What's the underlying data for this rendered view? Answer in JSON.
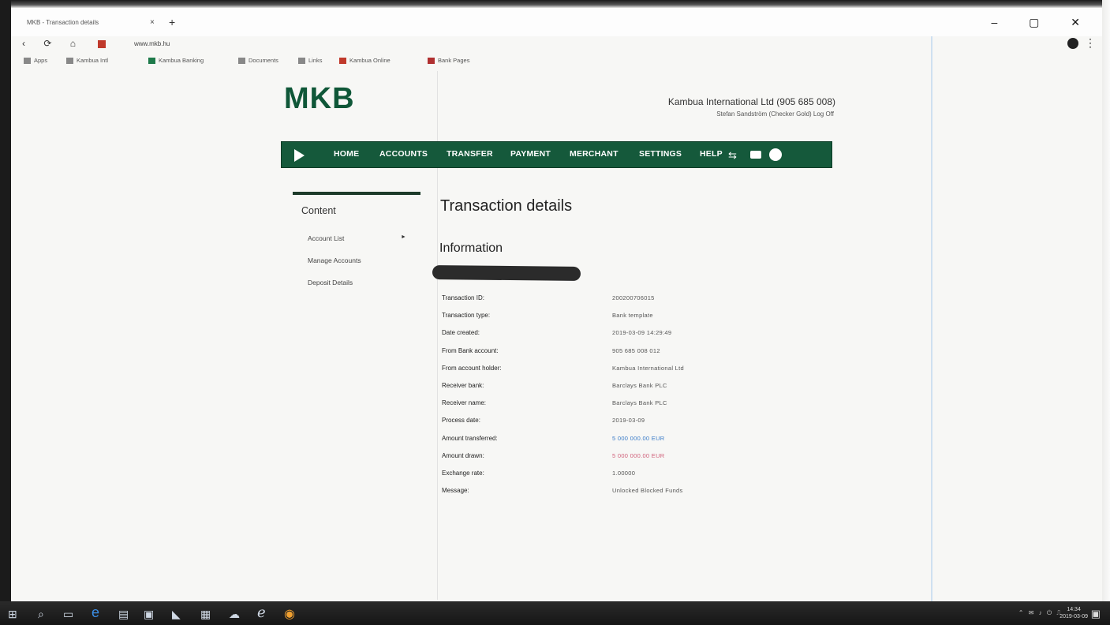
{
  "browser": {
    "tab_title": "MKB - Transaction details",
    "tab_close": "×",
    "new_tab": "+",
    "window_controls": "– ▢ ✕",
    "nav_icons": "‹ ⟳ ⌂",
    "url": "www.mkb.hu",
    "profile_icon": "profile-icon",
    "menu_icon": "⋮",
    "bookmarks": [
      {
        "label": "Apps",
        "color": "#888888"
      },
      {
        "label": "Kambua Intl",
        "color": "#888888"
      },
      {
        "label": "Kambua Banking",
        "color": "#1e7a4a"
      },
      {
        "label": "Documents",
        "color": "#888888"
      },
      {
        "label": "Links",
        "color": "#888888"
      },
      {
        "label": "Kambua Online",
        "color": "#c0392b"
      },
      {
        "label": "Bank Pages",
        "color": "#b03030"
      }
    ]
  },
  "header": {
    "logo": "MKB",
    "company": "Kambua International Ltd (905 685 008)",
    "user": "Stefan Sandström (Checker Gold) Log Off"
  },
  "nav": {
    "items": [
      "HOME",
      "ACCOUNTS",
      "TRANSFER",
      "PAYMENT",
      "MERCHANT",
      "SETTINGS",
      "HELP"
    ],
    "transfer_icon": "⇆"
  },
  "sidebar": {
    "title": "Content",
    "links": [
      "Account List",
      "Manage Accounts",
      "Deposit Details"
    ],
    "arrow": "►"
  },
  "main": {
    "title": "Transaction details",
    "section": "Information",
    "rows": [
      {
        "label": "Transaction ID:",
        "value": "200200706015",
        "color": "#555555"
      },
      {
        "label": "Transaction type:",
        "value": "Bank template",
        "color": "#555555"
      },
      {
        "label": "Date created:",
        "value": "2019-03-09 14:29:49",
        "color": "#555555"
      },
      {
        "label": "From Bank account:",
        "value": "905 685 008 012",
        "color": "#555555"
      },
      {
        "label": "From account holder:",
        "value": "Kambua International Ltd",
        "color": "#555555"
      },
      {
        "label": "Receiver bank:",
        "value": "Barclays Bank PLC",
        "color": "#555555"
      },
      {
        "label": "Receiver name:",
        "value": "Barclays Bank PLC",
        "color": "#555555"
      },
      {
        "label": "Process date:",
        "value": "2019-03-09",
        "color": "#555555"
      },
      {
        "label": "Amount transferred:",
        "value": "5 000 000.00 EUR",
        "color": "#3a7bc8"
      },
      {
        "label": "Amount drawn:",
        "value": "5 000 000.00 EUR",
        "color": "#d0607a"
      },
      {
        "label": "Exchange rate:",
        "value": "1.00000",
        "color": "#555555"
      },
      {
        "label": "Message:",
        "value": "Unlocked Blocked Funds",
        "color": "#555555"
      }
    ]
  },
  "taskbar": {
    "icons": [
      "⊞",
      "⌕",
      "▭",
      "e",
      "▤",
      "▣",
      "◣",
      "▦",
      "☁",
      "ℯ",
      "◉"
    ],
    "system_tray": "⌃ ✉ ♪ ⏻ ⎍",
    "time": "14:34",
    "date": "2019-03-09",
    "notification_icon": "▣"
  }
}
